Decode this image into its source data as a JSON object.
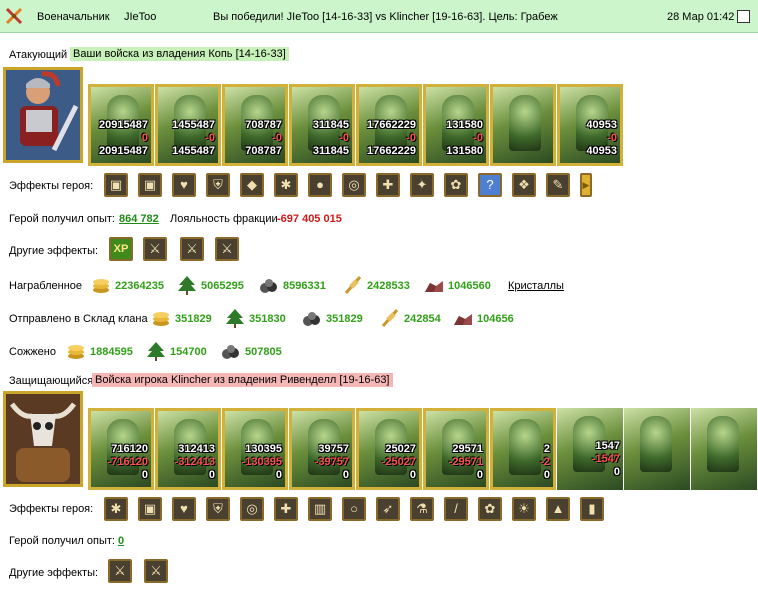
{
  "top": {
    "role": "Военачальник",
    "player": "JIeToo",
    "result": "Вы победили! JIeToo [14-16-33] vs Klincher [19-16-63]. Цель: Грабеж",
    "datetime": "28 Мар 01:42"
  },
  "attacker": {
    "label": "Атакующий",
    "source": "Ваши войска из владения Копь [14-16-33]",
    "units": [
      {
        "count": "20915487",
        "loss": "0",
        "after": "20915487"
      },
      {
        "count": "1455487",
        "loss": "-0",
        "after": "1455487"
      },
      {
        "count": "708787",
        "loss": "-0",
        "after": "708787"
      },
      {
        "count": "311845",
        "loss": "-0",
        "after": "311845"
      },
      {
        "count": "17662229",
        "loss": "-0",
        "after": "17662229"
      },
      {
        "count": "131580",
        "loss": "-0",
        "after": "131580"
      },
      {
        "count": "",
        "loss": "",
        "after": ""
      },
      {
        "count": "40953",
        "loss": "-0",
        "after": "40953"
      }
    ],
    "effects_label": "Эффекты героя:",
    "effect_icons": [
      "chest-icon",
      "chest-icon",
      "heart-icon",
      "shield-icon",
      "ore-icon",
      "spider-icon",
      "gem-icon",
      "amulet-icon",
      "cross-icon",
      "wings-icon",
      "flower-icon",
      "question-icon",
      "dragon-icon",
      "scroll-icon",
      "arrow-right-icon"
    ],
    "exp_label": "Герой получил опыт:",
    "exp_value": "864 782",
    "loyalty_label": "Лояльность фракции",
    "loyalty_value": "-697 405 015",
    "other_label": "Другие эффекты:",
    "other_icons": [
      "xp-icon",
      "sword-icon",
      "sword-icon",
      "sword-icon"
    ],
    "other_xp_text": "XP"
  },
  "loot": {
    "label": "Награбленное",
    "items": [
      {
        "icon": "gold-icon",
        "value": "22364235"
      },
      {
        "icon": "wood-icon",
        "value": "5065295"
      },
      {
        "icon": "ore-icon",
        "value": "8596331"
      },
      {
        "icon": "grain-icon",
        "value": "2428533"
      },
      {
        "icon": "stone-icon",
        "value": "1046560"
      }
    ],
    "crystals_link": "Кристаллы"
  },
  "clan": {
    "label": "Отправлено в Склад клана",
    "items": [
      {
        "icon": "gold-icon",
        "value": "351829"
      },
      {
        "icon": "wood-icon",
        "value": "351830"
      },
      {
        "icon": "ore-icon",
        "value": "351829"
      },
      {
        "icon": "grain-icon",
        "value": "242854"
      },
      {
        "icon": "stone-icon",
        "value": "104656"
      }
    ]
  },
  "burned": {
    "label": "Сожжено",
    "items": [
      {
        "icon": "gold-icon",
        "value": "1884595"
      },
      {
        "icon": "wood-icon",
        "value": "154700"
      },
      {
        "icon": "ore-icon",
        "value": "507805"
      }
    ]
  },
  "defender": {
    "label": "Защищающийся",
    "source": "Войска игрока Klincher из владения Ривенделл [19-16-63]",
    "units": [
      {
        "count": "716120",
        "loss": "-716120",
        "after": "0"
      },
      {
        "count": "312413",
        "loss": "-312413",
        "after": "0"
      },
      {
        "count": "130395",
        "loss": "-130395",
        "after": "0"
      },
      {
        "count": "39757",
        "loss": "-39757",
        "after": "0"
      },
      {
        "count": "25027",
        "loss": "-25027",
        "after": "0"
      },
      {
        "count": "29571",
        "loss": "-29571",
        "after": "0"
      },
      {
        "count": "2",
        "loss": "-2",
        "after": "0"
      },
      {
        "count": "1547",
        "loss": "-1547",
        "after": "0"
      },
      {
        "count": "",
        "loss": "",
        "after": ""
      },
      {
        "count": "",
        "loss": "",
        "after": ""
      }
    ],
    "effects_label": "Эффекты героя:",
    "effect_icons": [
      "spider-icon",
      "chest-icon",
      "heart-icon",
      "shield-icon",
      "amulet-icon",
      "cross-icon",
      "armor-icon",
      "ring-icon",
      "bow-icon",
      "potion-icon",
      "staff-icon",
      "flower-icon",
      "sun-icon",
      "cloak-icon",
      "boots-icon"
    ],
    "exp_label": "Герой получил опыт:",
    "exp_value": "0",
    "other_label": "Другие эффекты:",
    "other_icons": [
      "sword-icon",
      "sword-icon"
    ]
  }
}
